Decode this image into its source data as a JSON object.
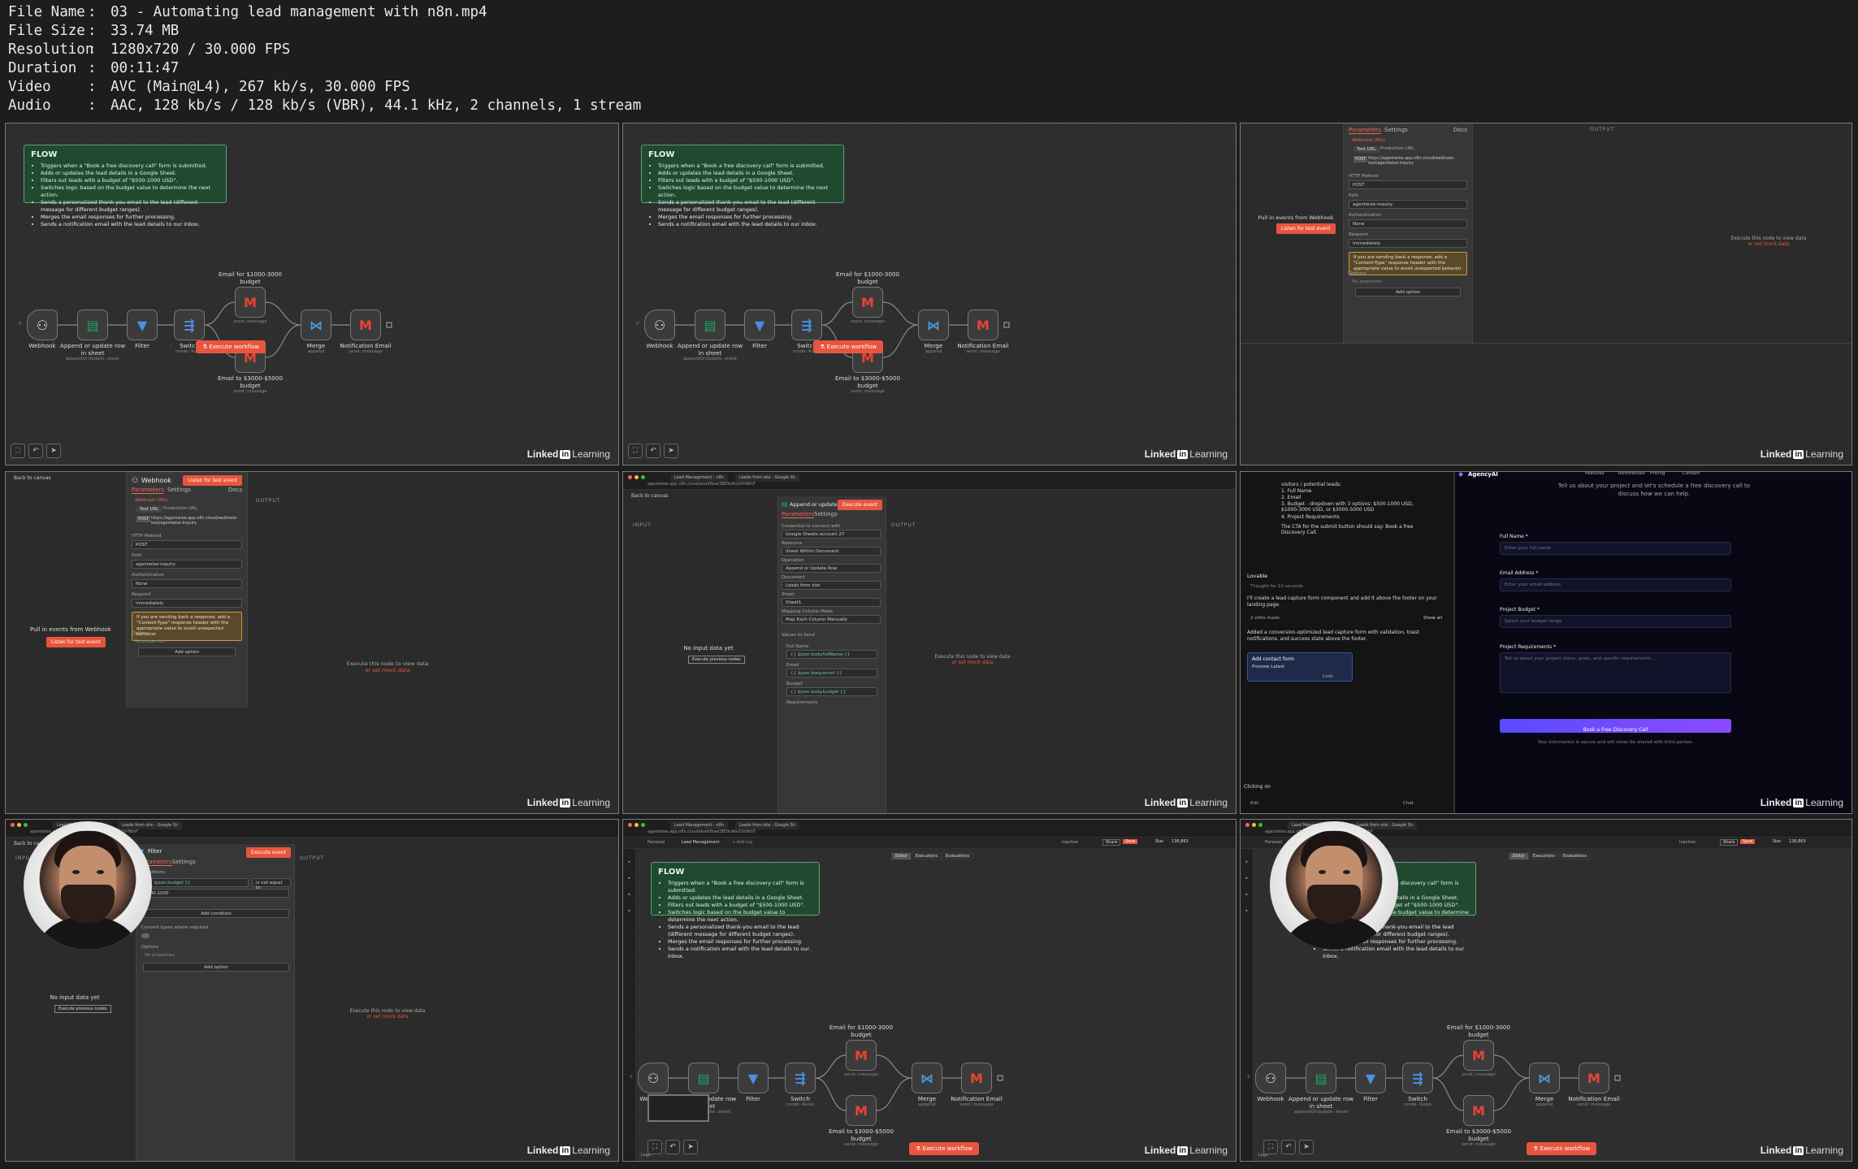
{
  "file_info": [
    {
      "key": "File Name",
      "value": "03 - Automating lead management with n8n.mp4"
    },
    {
      "key": "File Size",
      "value": "33.74 MB"
    },
    {
      "key": "Resolution",
      "value": "1280x720 / 30.000 FPS"
    },
    {
      "key": "Duration",
      "value": "00:11:47"
    },
    {
      "key": "Video",
      "value": "AVC (Main@L4), 267 kb/s, 30.000 FPS"
    },
    {
      "key": "Audio",
      "value": "AAC, 128 kb/s / 128 kb/s (VBR), 44.1 kHz, 2 channels, 1 stream"
    }
  ],
  "watermark": {
    "brand": "Linked",
    "in": "in",
    "suffix": "Learning"
  },
  "flow": {
    "title": "FLOW",
    "bullets": [
      "Triggers when a \"Book a free discovery call\" form is submitted.",
      "Adds or updates the lead details in a Google Sheet.",
      "Filters out leads with a budget of \"$500-1000 USD\".",
      "Switches logic based on the budget value to determine the next action.",
      "Sends a personalized thank-you email to the lead (different message for different budget ranges).",
      "Merges the email responses for further processing.",
      "Sends a notification email with the lead details to our inbox."
    ]
  },
  "nodes": {
    "webhook": "Webhook",
    "append": "Append or update row in sheet",
    "append_sub": "appendOrUpdate: sheet",
    "filter": "Filter",
    "switch": "Switch",
    "switch_sub": "mode: Rules",
    "email1": "Email for $1000-3000 budget",
    "email2": "Email to $3000-$5000 budget",
    "send_sub": "send: message",
    "merge": "Merge",
    "merge_sub": "append",
    "notify": "Notification Email"
  },
  "execute_workflow": "Execute workflow",
  "webhook_panel": {
    "title": "Webhook",
    "listen": "Listen for test event",
    "tab_params": "Parameters",
    "tab_settings": "Settings",
    "docs": "Docs",
    "webhook_urls": "Webhook URLs",
    "test_url": "Test URL",
    "prod_url": "Production URL",
    "method": "POST",
    "url": "https://agentwise.app.n8n.cloud/webhook-test/agentwise-inquiry",
    "http_method_label": "HTTP Method",
    "path_label": "Path",
    "path_value": "agentwise-inquiry",
    "auth_label": "Authentication",
    "auth_value": "None",
    "respond_label": "Respond",
    "respond_value": "Immediately",
    "warning": "If you are sending back a response, add a \"Content-Type\" response header with the appropriate value to avoid unexpected behavior",
    "options": "Options",
    "no_props": "No properties",
    "add_option": "Add option",
    "output": "OUTPUT",
    "pull": "Pull in events from Webhook",
    "listen_btn": "Listen for test event",
    "exec_hint": "Execute this node to view data",
    "mock": "or set mock data",
    "back": "Back to canvas"
  },
  "sheet_panel": {
    "title": "Append or update row in sheet",
    "input": "INPUT",
    "output": "OUTPUT",
    "no_input": "No input data yet",
    "exec_prev": "Execute previous nodes",
    "exec_event": "Execute event",
    "cred_label": "Credential to connect with",
    "cred_value": "Google Sheets account 27",
    "resource_label": "Resource",
    "resource_value": "Sheet Within Document",
    "op_label": "Operation",
    "op_value": "Append or Update Row",
    "doc_label": "Document",
    "doc_value": "Leads from site",
    "sheet_label": "Sheet",
    "sheet_value": "Sheet1",
    "map_label": "Mapping Column Mode",
    "map_value": "Map Each Column Manually",
    "values_label": "Values to Send",
    "f1": "Full Name",
    "f2": "Email",
    "f3": "Budget",
    "f4": "Requirements",
    "expr1": "{{ $json.body.fullName }}",
    "expr2": "{{ $json.body.email }}",
    "expr3": "{{ $json.body.budget }}"
  },
  "lovable": {
    "prompt_lines": [
      "visitors / potential leads:",
      "1. Full Name",
      "2. Email",
      "3. Budget - dropdown with 3 options: $500-1000 USD, $1000-3000 USD, or $3000-5000 USD",
      "4. Project Requirements"
    ],
    "cta": "The CTA for the submit button should say: Book a free Discovery Call.",
    "brand": "Lovable",
    "thought": "Thought for 10 seconds",
    "reply": "I'll create a lead capture form component and add it above the footer on your landing page.",
    "edits": "2 edits made",
    "show_all": "Show all",
    "summary": "Added a conversion-optimized lead capture form with validation, toast notifications, and success state above the footer.",
    "card_title": "Add contact form",
    "card_sub": "Preview Latest",
    "code": "Code",
    "clicking": "Clicking on",
    "edit": "Edit",
    "chat": "Chat",
    "site_name": "AgencyAI",
    "nav": [
      "Features",
      "Testimonials",
      "Pricing",
      "Contact"
    ],
    "headline": "Tell us about your project and let's schedule a free discovery call to discuss how we can help.",
    "full_name": "Full Name *",
    "full_name_ph": "Enter your full name",
    "email": "Email Address *",
    "email_ph": "Enter your email address",
    "budget": "Project Budget *",
    "budget_ph": "Select your budget range",
    "req": "Project Requirements *",
    "req_ph": "Tell us about your project vision, goals, and specific requirements...",
    "submit": "Book a Free Discovery Call",
    "secure": "Your information is secure and will never be shared with third parties."
  },
  "filter_panel": {
    "title": "Filter",
    "conditions": "Conditions",
    "cond_left": "{{ $json.budget }}",
    "cond_op": "is not equal to",
    "cond_right": "500-1000",
    "add_condition": "Add condition",
    "convert": "Convert types where required",
    "options": "Options",
    "no_props": "No properties",
    "add_option": "Add option",
    "input": "INPUT",
    "output": "OUTPUT",
    "no_input": "No input data yet",
    "exec_prev": "Execute previous nodes",
    "exec_hint": "Execute this node to view data",
    "mock": "or set mock data",
    "back": "Back to canvas"
  },
  "editor": {
    "personal": "Personal",
    "workflow": "Lead Management",
    "add_tag": "+ Add tag",
    "inactive": "Inactive",
    "share": "Share",
    "save": "Save",
    "star": "Star",
    "stars": "136,863",
    "tab_editor": "Editor",
    "tab_exec": "Executions",
    "tab_eval": "Evaluations",
    "logs": "Logs"
  },
  "browser": {
    "tab1": "Lead Management - n8n",
    "tab2": "Leads from site - Google Sh",
    "url": "agentwise.app.n8n.cloud/workflow/3B5fuAm2VrNkhF"
  },
  "colors": {
    "sticky": "#1f4a30",
    "accent": "#e8553e",
    "submit": "#6d4aff"
  }
}
